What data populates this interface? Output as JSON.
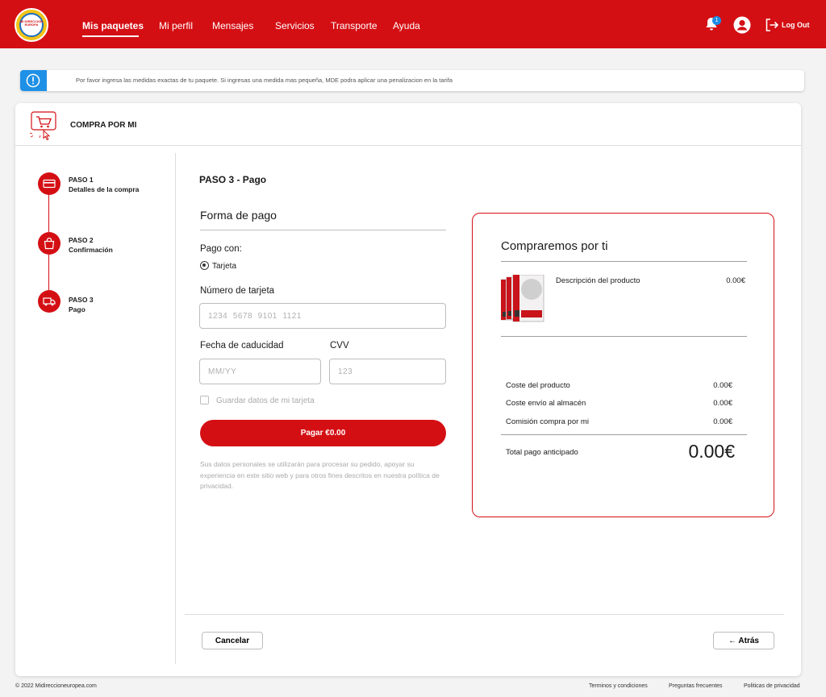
{
  "header": {
    "logo_text": "MI DIRECCION EUROPA",
    "nav": [
      "Mis paquetes",
      "Mi perfil",
      "Mensajes",
      "Servicios",
      "Transporte",
      "Ayuda"
    ],
    "notification_count": "1",
    "logout_label": "Log Out",
    "brand_color": "#d40f14"
  },
  "notice": {
    "icon": "info-icon",
    "text": "Por favor ingresa las medidas exactas de tu paquete. Si ingresas una medida mas pequeña, MDE podra aplicar una penalizacion en la tarifa"
  },
  "card": {
    "title": "COMPRA POR MI",
    "icon": "cart-click-icon"
  },
  "steps": [
    {
      "num": "PASO 1",
      "name": "Detalles de la compra",
      "icon": "card-icon"
    },
    {
      "num": "PASO 2",
      "name": "Confirmación",
      "icon": "bag-icon"
    },
    {
      "num": "PASO 3",
      "name": "Pago",
      "icon": "truck-icon"
    }
  ],
  "form": {
    "step_title": "PASO 3 - Pago",
    "section_title": "Forma de pago",
    "pay_with_label": "Pago con:",
    "method_option": "Tarjeta",
    "card_number_label": "Número de tarjeta",
    "card_number_placeholder": "1234  5678  9101  1121",
    "expiry_label": "Fecha de caducidad",
    "expiry_placeholder": "MM/YY",
    "cvv_label": "CVV",
    "cvv_placeholder": "123",
    "save_card_label": "Guardar datos de mi tarjeta",
    "pay_button": "Pagar €0.00",
    "privacy_text": "Sus datos personales se utilizarán para procesar su pedido, apoyar su experiencia en este sitio web y para otros fines descritos en nuestra política de privacidad."
  },
  "summary": {
    "title": "Compraremos por ti",
    "product_description": "Descripción del producto",
    "product_price": "0.00€",
    "rows": [
      {
        "label": "Coste del producto",
        "value": "0.00€"
      },
      {
        "label": "Coste envío al almacén",
        "value": "0.00€"
      },
      {
        "label": "Comisión compra por mi",
        "value": "0.00€"
      }
    ],
    "total_label": "Total pago anticipado",
    "total_value": "0.00€"
  },
  "actions": {
    "cancel": "Cancelar",
    "back": "← Atrás"
  },
  "footer": {
    "copyright": "© 2022 Midireccioneuropea.com",
    "links": [
      "Terminos y condiciones",
      "Preguntas frecuentes",
      "Politicas de privacidad"
    ]
  }
}
